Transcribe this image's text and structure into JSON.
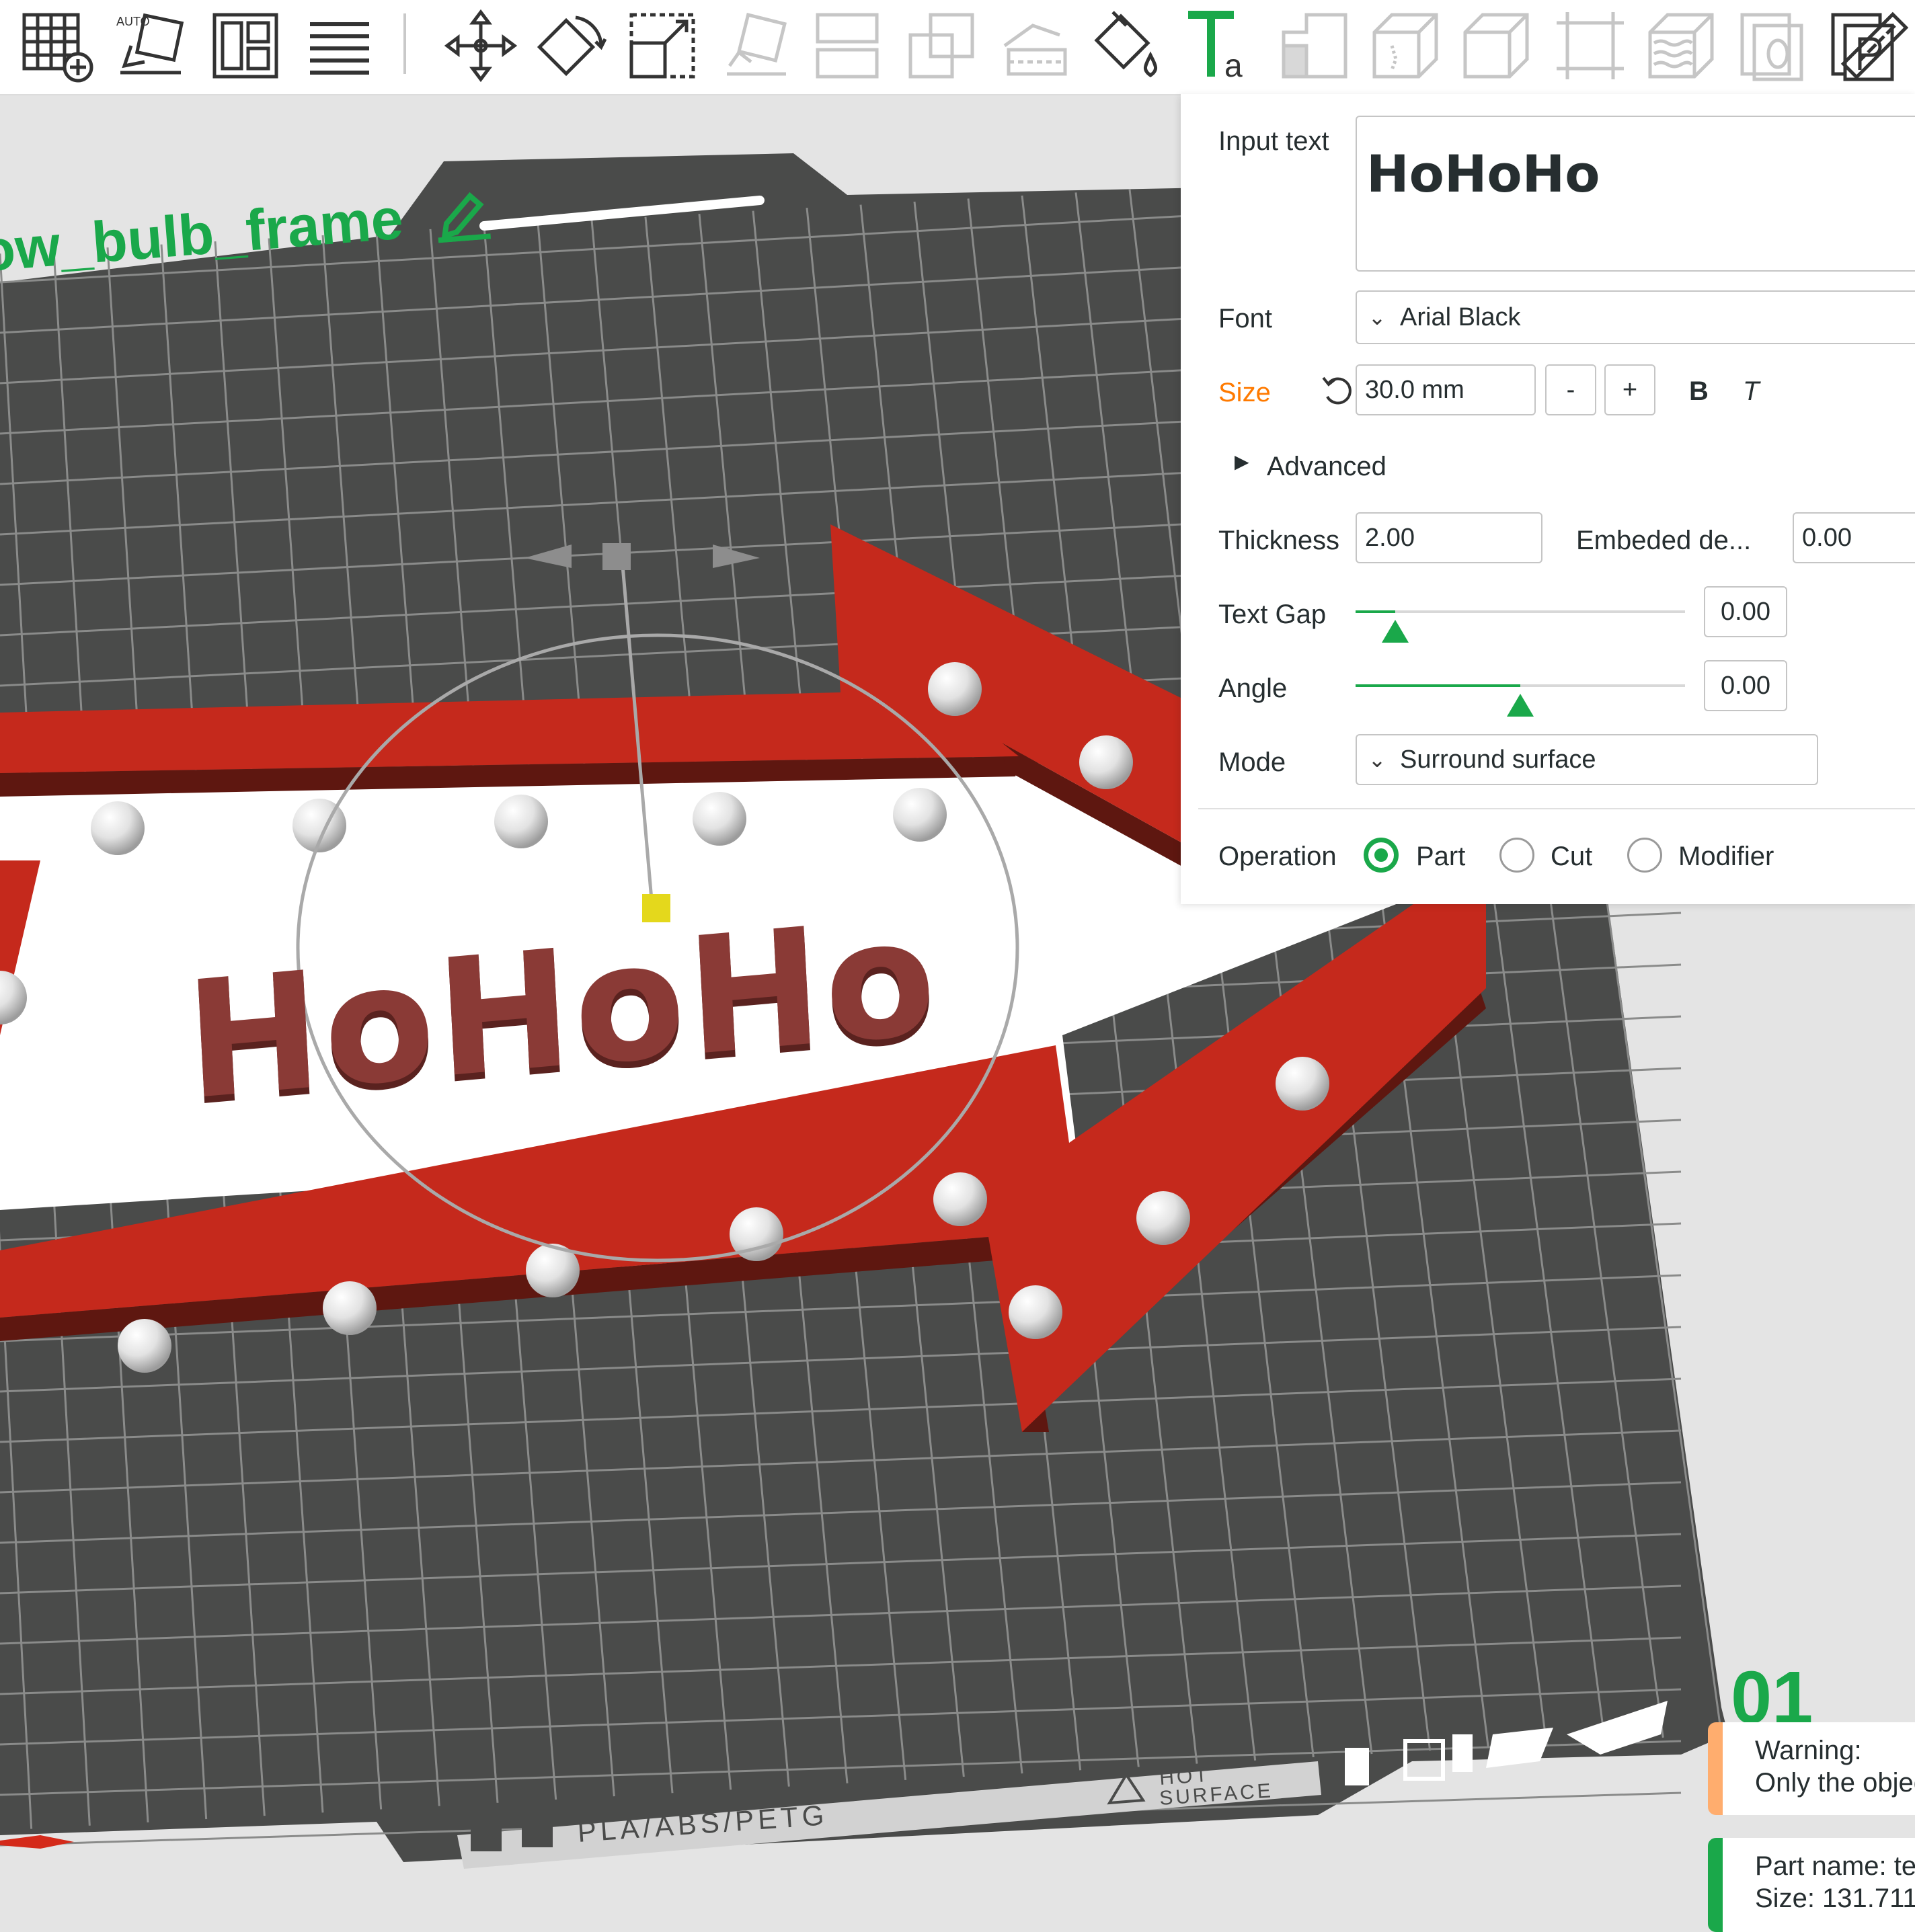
{
  "toolbar": {
    "icons": [
      "add-plate-icon",
      "auto-orient-icon",
      "arrange-icon",
      "layers-icon",
      "move-icon",
      "rotate-icon",
      "scale-icon",
      "lay-on-face-icon",
      "split-objects-icon",
      "split-parts-icon",
      "cut-icon",
      "paint-icon",
      "text-tool-icon",
      "support-paint-icon",
      "seam-paint-icon",
      "cube-icon",
      "fit-icon",
      "fuzzy-skin-icon",
      "assembly-icon",
      "plate-p-icon",
      "measure-icon"
    ]
  },
  "viewport": {
    "plate_name": "ow_bulb_frame",
    "plate_number": "01",
    "model_text": "HoHoHo",
    "bed_label": "PLA/ABS/PETG",
    "bed_hot": [
      "HOT",
      "SURFACE"
    ]
  },
  "text_panel": {
    "input_text_label": "Input text",
    "input_text_value": "HoHoHo",
    "font_label": "Font",
    "font_value": "Arial Black",
    "size_label": "Size",
    "size_value": "30.0 mm",
    "size_minus": "-",
    "size_plus": "+",
    "bold_label": "B",
    "italic_label": "T",
    "advanced_label": "Advanced",
    "thickness_label": "Thickness",
    "thickness_value": "2.00",
    "embedded_label": "Embeded de...",
    "embedded_value": "0.00",
    "text_gap_label": "Text Gap",
    "text_gap_value": "0.00",
    "text_gap_level": 0.12,
    "angle_label": "Angle",
    "angle_value": "0.00",
    "angle_level": 0.5,
    "mode_label": "Mode",
    "mode_value": "Surround surface",
    "operation_label": "Operation",
    "operations": [
      {
        "label": "Part",
        "selected": true
      },
      {
        "label": "Cut",
        "selected": false
      },
      {
        "label": "Modifier",
        "selected": false
      }
    ]
  },
  "notifications": {
    "warning_title": "Warning:",
    "warning_body": "Only the objec",
    "part_name": "Part name: tex",
    "part_size": "Size: 131.711"
  },
  "colors": {
    "accent": "#1aa84a",
    "size_label": "#ff7a00",
    "frame_red": "#c5291c",
    "text_model": "#8a3a36",
    "bed": "#4a4b4a",
    "warning": "#ffad6e"
  }
}
